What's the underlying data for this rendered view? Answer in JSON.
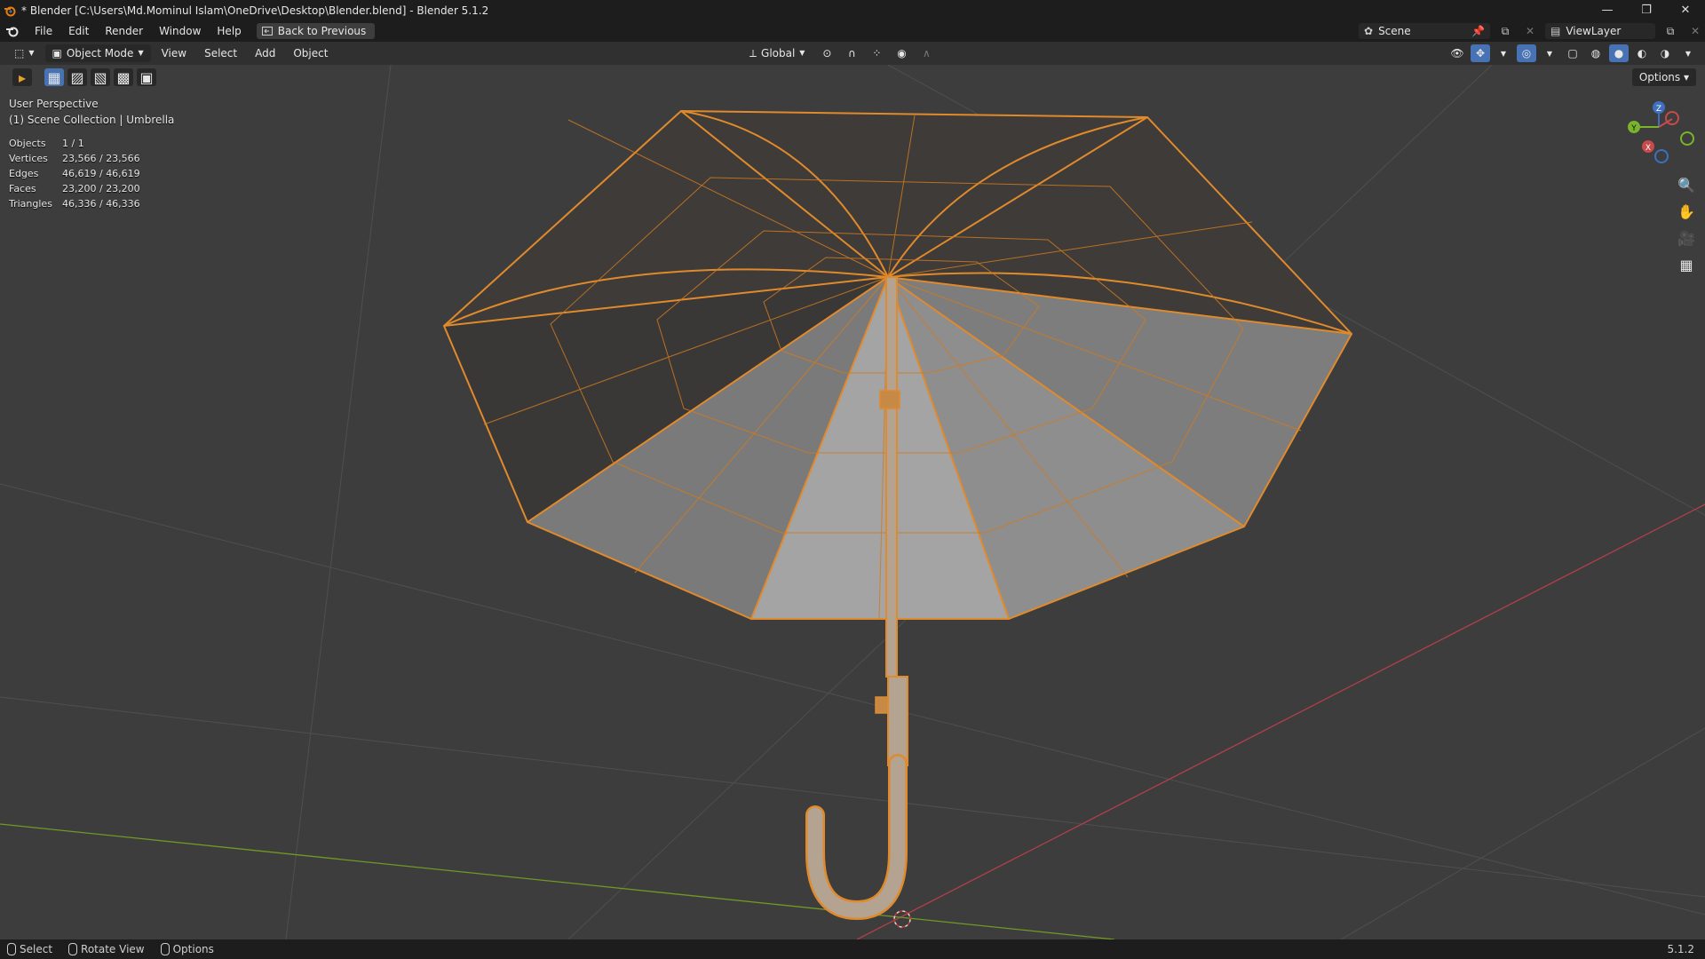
{
  "window": {
    "title": "* Blender [C:\\Users\\Md.Mominul Islam\\OneDrive\\Desktop\\Blender.blend] - Blender 5.1.2",
    "controls": [
      "—",
      "❐",
      "✕"
    ]
  },
  "menubar": {
    "items": [
      "File",
      "Edit",
      "Render",
      "Window",
      "Help"
    ],
    "back_button": "Back to Previous",
    "scene": "Scene",
    "view_layer": "ViewLayer"
  },
  "header": {
    "mode": "Object Mode",
    "menus": [
      "View",
      "Select",
      "Add",
      "Object"
    ],
    "transform_orientation": "Global",
    "options": "Options"
  },
  "viewport": {
    "perspective": "User Perspective",
    "collection": "(1) Scene Collection | Umbrella",
    "stats": [
      {
        "label": "Objects",
        "value": "1 / 1"
      },
      {
        "label": "Vertices",
        "value": "23,566 / 23,566"
      },
      {
        "label": "Edges",
        "value": "46,619 / 46,619"
      },
      {
        "label": "Faces",
        "value": "23,200 / 23,200"
      },
      {
        "label": "Triangles",
        "value": "46,336 / 46,336"
      }
    ],
    "gizmo_axes": {
      "x": "X",
      "y": "Y",
      "z": "Z"
    },
    "colors": {
      "selection": "#e08a2c",
      "x_axis": "#c03e4e",
      "y_axis": "#7aa82a",
      "background": "#3d3d3d"
    }
  },
  "statusbar": {
    "items": [
      "Select",
      "Rotate View",
      "Options"
    ],
    "version": "5.1.2"
  }
}
